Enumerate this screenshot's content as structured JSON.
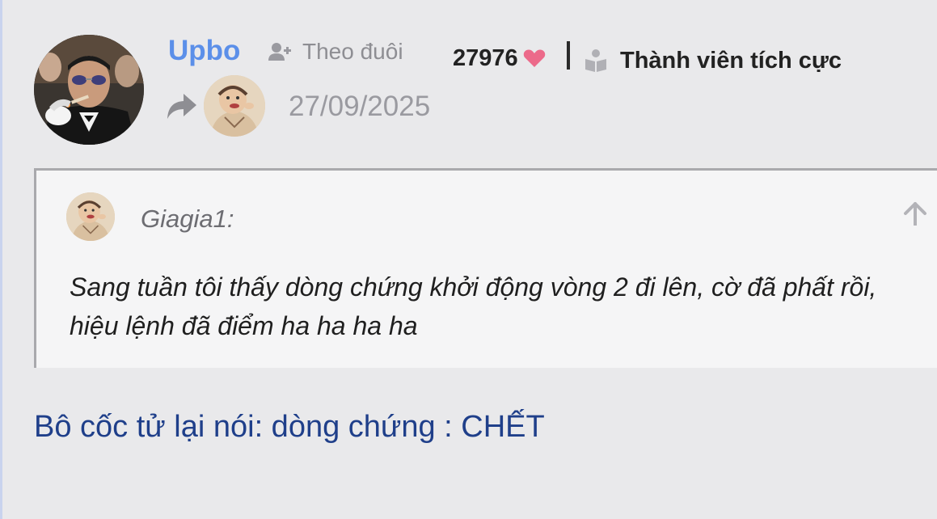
{
  "post": {
    "author": "Upbo",
    "follow_label": "Theo đuôi",
    "score": "27976",
    "rank": "Thành viên tích cực",
    "date": "27/09/2025"
  },
  "quote": {
    "author": "Giagia1:",
    "text": "Sang tuần tôi thấy dòng chứng khởi động vòng 2 đi lên, cờ đã phất rồi, hiệu lệnh đã điểm ha ha ha ha"
  },
  "reply": {
    "text": "Bô cốc tử lại nói: dòng chứng : CHẾT"
  },
  "icons": {
    "follow": "user-plus-icon",
    "heart": "heart-icon",
    "rank": "book-reader-icon",
    "share": "share-arrow-icon",
    "jump": "arrow-up-icon"
  },
  "colors": {
    "username": "#5b8fe9",
    "heart": "#ec6a8a",
    "reply": "#1f3f8a",
    "background": "#e9e9eb",
    "quote_bg": "#f5f5f6"
  }
}
